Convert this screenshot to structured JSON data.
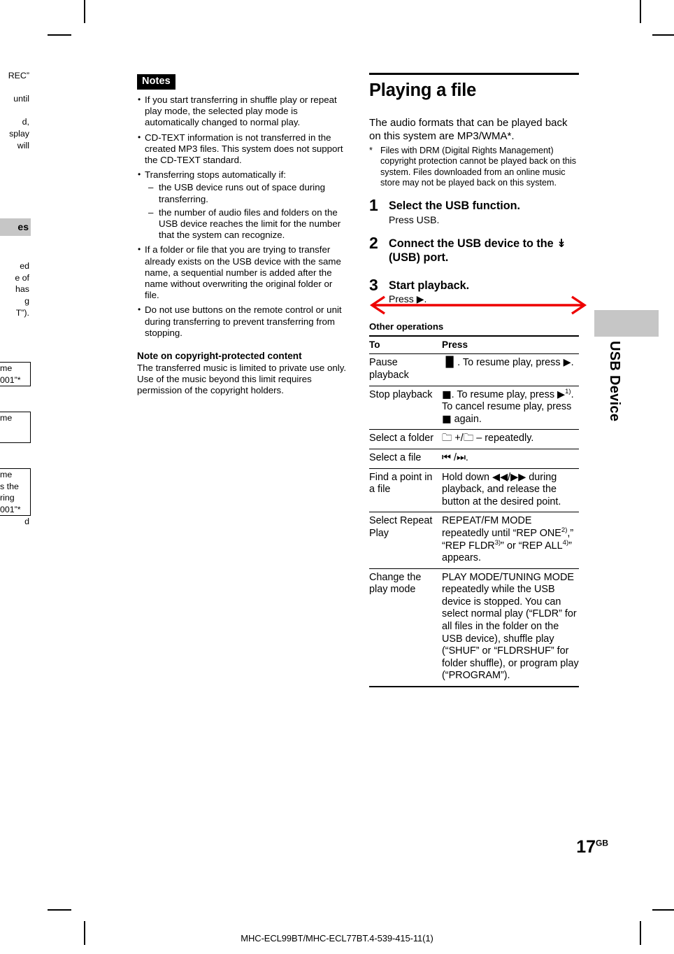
{
  "page": {
    "number": "17",
    "number_suffix": "GB",
    "footer": "MHC-ECL99BT/MHC-ECL77BT.4-539-415-11(1)",
    "side_tab": "USB Device"
  },
  "annotation": {
    "color": "#ee0000",
    "kind": "double-headed-arrow-line"
  },
  "left_bleed": {
    "fragments": [
      "REC”",
      "",
      "until",
      "",
      "d,",
      "splay",
      "will"
    ],
    "badge": "es",
    "fragments2": [
      "ed",
      "e of",
      "has",
      "g",
      "T”)."
    ],
    "boxes": [
      {
        "cells": [
          "me",
          "001”*"
        ]
      },
      {
        "cells": [
          "me",
          ""
        ]
      },
      {
        "cells": [
          "me",
          "s the\nring",
          "001”*"
        ]
      }
    ],
    "tail": "d"
  },
  "left_column": {
    "notes_badge": "Notes",
    "notes": [
      "If you start transferring in shuffle play or repeat play mode, the selected play mode is automatically changed to normal play.",
      "CD-TEXT information is not transferred in the created MP3 files. This system does not support the CD-TEXT standard.",
      "Transferring stops automatically if:"
    ],
    "dashes": [
      "the USB device runs out of space during transferring.",
      "the number of audio files and folders on the USB device reaches the limit for the number that the system can recognize."
    ],
    "notes_cont": [
      "If a folder or file that you are trying to transfer already exists on the USB device with the same name, a sequential number is added after the name without overwriting the original folder or file.",
      "Do not use buttons on the remote control or unit during transferring to prevent transferring from stopping."
    ],
    "copyright_heading": "Note on copyright-protected content",
    "copyright_body": "The transferred music is limited to private use only. Use of the music beyond this limit requires permission of the copyright holders."
  },
  "right_column": {
    "section_title": "Playing a file",
    "intro": "The audio formats that can be played back on this system are MP3/WMA*.",
    "footnote_mark": "*",
    "footnote_text": "Files with DRM (Digital Rights Management) copyright protection cannot be played back on this system. Files downloaded from an online music store may not be played back on this system.",
    "steps": [
      {
        "num": "1",
        "head": "Select the USB function.",
        "detail": "Press USB."
      },
      {
        "num": "2",
        "head_pre": "Connect the USB device to the ",
        "head_icon": "usb-trident-icon",
        "head_post": " (USB) port.",
        "detail": ""
      },
      {
        "num": "3",
        "head": "Start playback.",
        "detail_pre": "Press ",
        "detail_icon": "play-icon",
        "detail_post": "."
      }
    ],
    "other_operations_heading": "Other operations",
    "table": {
      "headers": [
        "To",
        "Press"
      ],
      "rows": [
        {
          "to": "Pause playback",
          "press_parts": [
            {
              "t": "icon",
              "v": "▐▌",
              "name": "pause-icon"
            },
            {
              "t": "text",
              "v": ". To resume play, press "
            },
            {
              "t": "icon",
              "v": "▶",
              "name": "play-icon"
            },
            {
              "t": "text",
              "v": "."
            }
          ]
        },
        {
          "to": "Stop playback",
          "press_parts": [
            {
              "t": "icon",
              "v": "■",
              "name": "stop-icon"
            },
            {
              "t": "text",
              "v": ". To resume play, press "
            },
            {
              "t": "icon",
              "v": "▶",
              "name": "play-icon"
            },
            {
              "t": "sup",
              "v": "1)"
            },
            {
              "t": "text",
              "v": ". To cancel resume play, press "
            },
            {
              "t": "icon",
              "v": "■",
              "name": "stop-icon"
            },
            {
              "t": "text",
              "v": " again."
            }
          ]
        },
        {
          "to": "Select a folder",
          "press_parts": [
            {
              "t": "icon",
              "v": "🗀",
              "name": "folder-icon"
            },
            {
              "t": "text",
              "v": " +/"
            },
            {
              "t": "icon",
              "v": "🗀",
              "name": "folder-icon"
            },
            {
              "t": "text",
              "v": " – repeatedly."
            }
          ]
        },
        {
          "to": "Select a file",
          "press_parts": [
            {
              "t": "icon",
              "v": "⏮",
              "name": "previous-track-icon"
            },
            {
              "t": "text",
              "v": " /"
            },
            {
              "t": "icon",
              "v": "⏭",
              "name": "next-track-icon"
            },
            {
              "t": "text",
              "v": "."
            }
          ]
        },
        {
          "to": "Find a point in a file",
          "press_parts": [
            {
              "t": "text",
              "v": "Hold down "
            },
            {
              "t": "icon",
              "v": "◀◀",
              "name": "rewind-icon"
            },
            {
              "t": "text",
              "v": "/"
            },
            {
              "t": "icon",
              "v": "▶▶",
              "name": "fast-forward-icon"
            },
            {
              "t": "text",
              "v": " during playback, and release the button at the desired point."
            }
          ]
        },
        {
          "to": "Select Repeat Play",
          "press_parts": [
            {
              "t": "text",
              "v": "REPEAT/FM MODE repeatedly until “REP ONE"
            },
            {
              "t": "sup",
              "v": "2)"
            },
            {
              "t": "text",
              "v": ",” “REP FLDR"
            },
            {
              "t": "sup",
              "v": "3)"
            },
            {
              "t": "text",
              "v": "” or “REP ALL"
            },
            {
              "t": "sup",
              "v": "4)"
            },
            {
              "t": "text",
              "v": "” appears."
            }
          ]
        },
        {
          "to": "Change the play mode",
          "press_parts": [
            {
              "t": "text",
              "v": "PLAY MODE/TUNING MODE repeatedly while the USB device is stopped. You can select normal play (“FLDR” for all files in the folder on the USB device), shuffle play (“SHUF” or “FLDRSHUF” for folder shuffle), or program play (“PROGRAM”)."
            }
          ]
        }
      ]
    }
  }
}
